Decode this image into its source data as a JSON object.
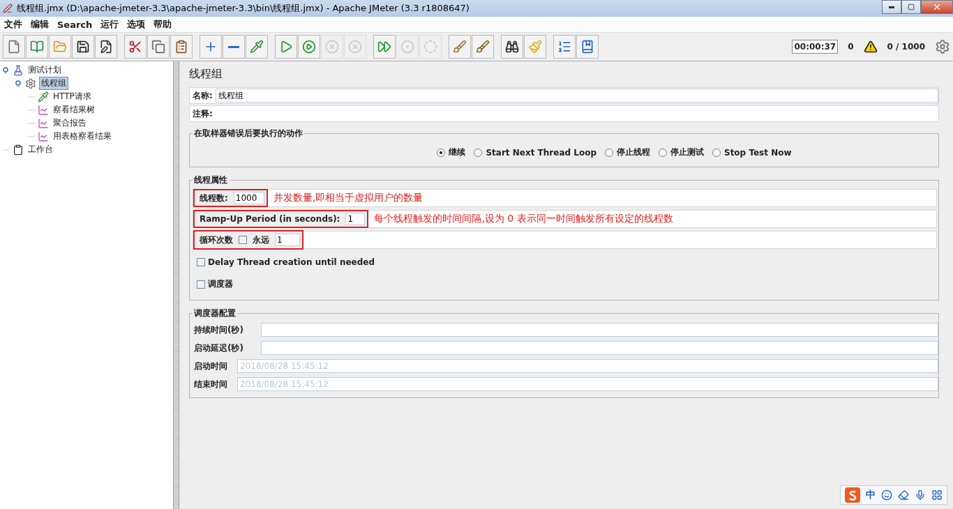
{
  "window": {
    "title": "线程组.jmx (D:\\apache-jmeter-3.3\\apache-jmeter-3.3\\bin\\线程组.jmx) - Apache JMeter (3.3 r1808647)"
  },
  "menu": [
    "文件",
    "编辑",
    "Search",
    "运行",
    "选项",
    "帮助"
  ],
  "toolbar": [
    [
      {
        "kind": "new",
        "disabled": false
      },
      {
        "kind": "templates",
        "disabled": false
      },
      {
        "kind": "open",
        "disabled": false
      },
      {
        "kind": "save",
        "disabled": false
      },
      {
        "kind": "save_as",
        "disabled": false
      }
    ],
    [
      {
        "kind": "cut",
        "disabled": false
      },
      {
        "kind": "copy",
        "disabled": false
      },
      {
        "kind": "paste",
        "disabled": false
      }
    ],
    [
      {
        "kind": "expand",
        "disabled": false
      },
      {
        "kind": "collapse",
        "disabled": false
      },
      {
        "kind": "toggle",
        "disabled": false
      }
    ],
    [
      {
        "kind": "start",
        "disabled": false
      },
      {
        "kind": "start_no_timers",
        "disabled": false
      },
      {
        "kind": "stop",
        "disabled": true
      },
      {
        "kind": "shutdown",
        "disabled": true
      }
    ],
    [
      {
        "kind": "remote_start",
        "disabled": false
      },
      {
        "kind": "remote_stop",
        "disabled": true
      },
      {
        "kind": "remote_exit",
        "disabled": true
      }
    ],
    [
      {
        "kind": "clear",
        "disabled": false
      },
      {
        "kind": "clear_all",
        "disabled": false
      }
    ],
    [
      {
        "kind": "search",
        "disabled": false
      },
      {
        "kind": "reset_search",
        "disabled": false
      }
    ],
    [
      {
        "kind": "function_helper",
        "disabled": false
      },
      {
        "kind": "help",
        "disabled": false
      }
    ]
  ],
  "status": {
    "timer": "00:00:37",
    "errors": "0",
    "threads": "0 / 1000"
  },
  "tree": [
    {
      "label": "测试计划",
      "kind": "plan",
      "selected": false,
      "expanded": true,
      "children": [
        {
          "label": "线程组",
          "kind": "thread_group",
          "selected": true,
          "expanded": true,
          "children": [
            {
              "label": "HTTP请求",
              "kind": "sampler",
              "selected": false
            },
            {
              "label": "察看结果树",
              "kind": "listener",
              "selected": false
            },
            {
              "label": "聚合报告",
              "kind": "listener",
              "selected": false
            },
            {
              "label": "用表格察看结果",
              "kind": "listener",
              "selected": false
            }
          ]
        }
      ]
    },
    {
      "label": "工作台",
      "kind": "workbench",
      "selected": false
    }
  ],
  "panel": {
    "title": "线程组",
    "name_label": "名称:",
    "name_value": "线程组",
    "comment_label": "注释:"
  },
  "error_action": {
    "legend": "在取样器错误后要执行的动作",
    "options": [
      {
        "label": "继续",
        "selected": true
      },
      {
        "label": "Start Next Thread Loop",
        "selected": false
      },
      {
        "label": "停止线程",
        "selected": false
      },
      {
        "label": "停止测试",
        "selected": false
      },
      {
        "label": "Stop Test Now",
        "selected": false
      }
    ]
  },
  "thread_props": {
    "legend": "线程属性",
    "threads": {
      "label": "线程数:",
      "value": "1000",
      "note": "并发数量,即相当于虚拟用户的数量",
      "highlighted": true
    },
    "rampup": {
      "label": "Ramp-Up Period (in seconds):",
      "value": "1",
      "note": "每个线程触发的时间间隔,设为  0  表示同一时间触发所有设定的线程数",
      "highlighted": true
    },
    "loop": {
      "label": "循环次数",
      "forever_label": "永远",
      "forever_checked": false,
      "value": "1",
      "highlighted": true
    },
    "delay": {
      "label": "Delay Thread creation until needed",
      "checked": false
    },
    "scheduler": {
      "label": "调度器",
      "checked": false
    }
  },
  "scheduler_config": {
    "legend": "调度器配置",
    "fields": [
      {
        "label": "持续时间(秒)"
      },
      {
        "label": "启动延迟(秒)"
      },
      {
        "label": "启动时间",
        "value": "2018/08/28 15:45:12",
        "disabled": true
      },
      {
        "label": "结束时间",
        "value": "2018/08/28 15:45:12",
        "disabled": true
      }
    ]
  },
  "ime": {
    "label": "中"
  }
}
